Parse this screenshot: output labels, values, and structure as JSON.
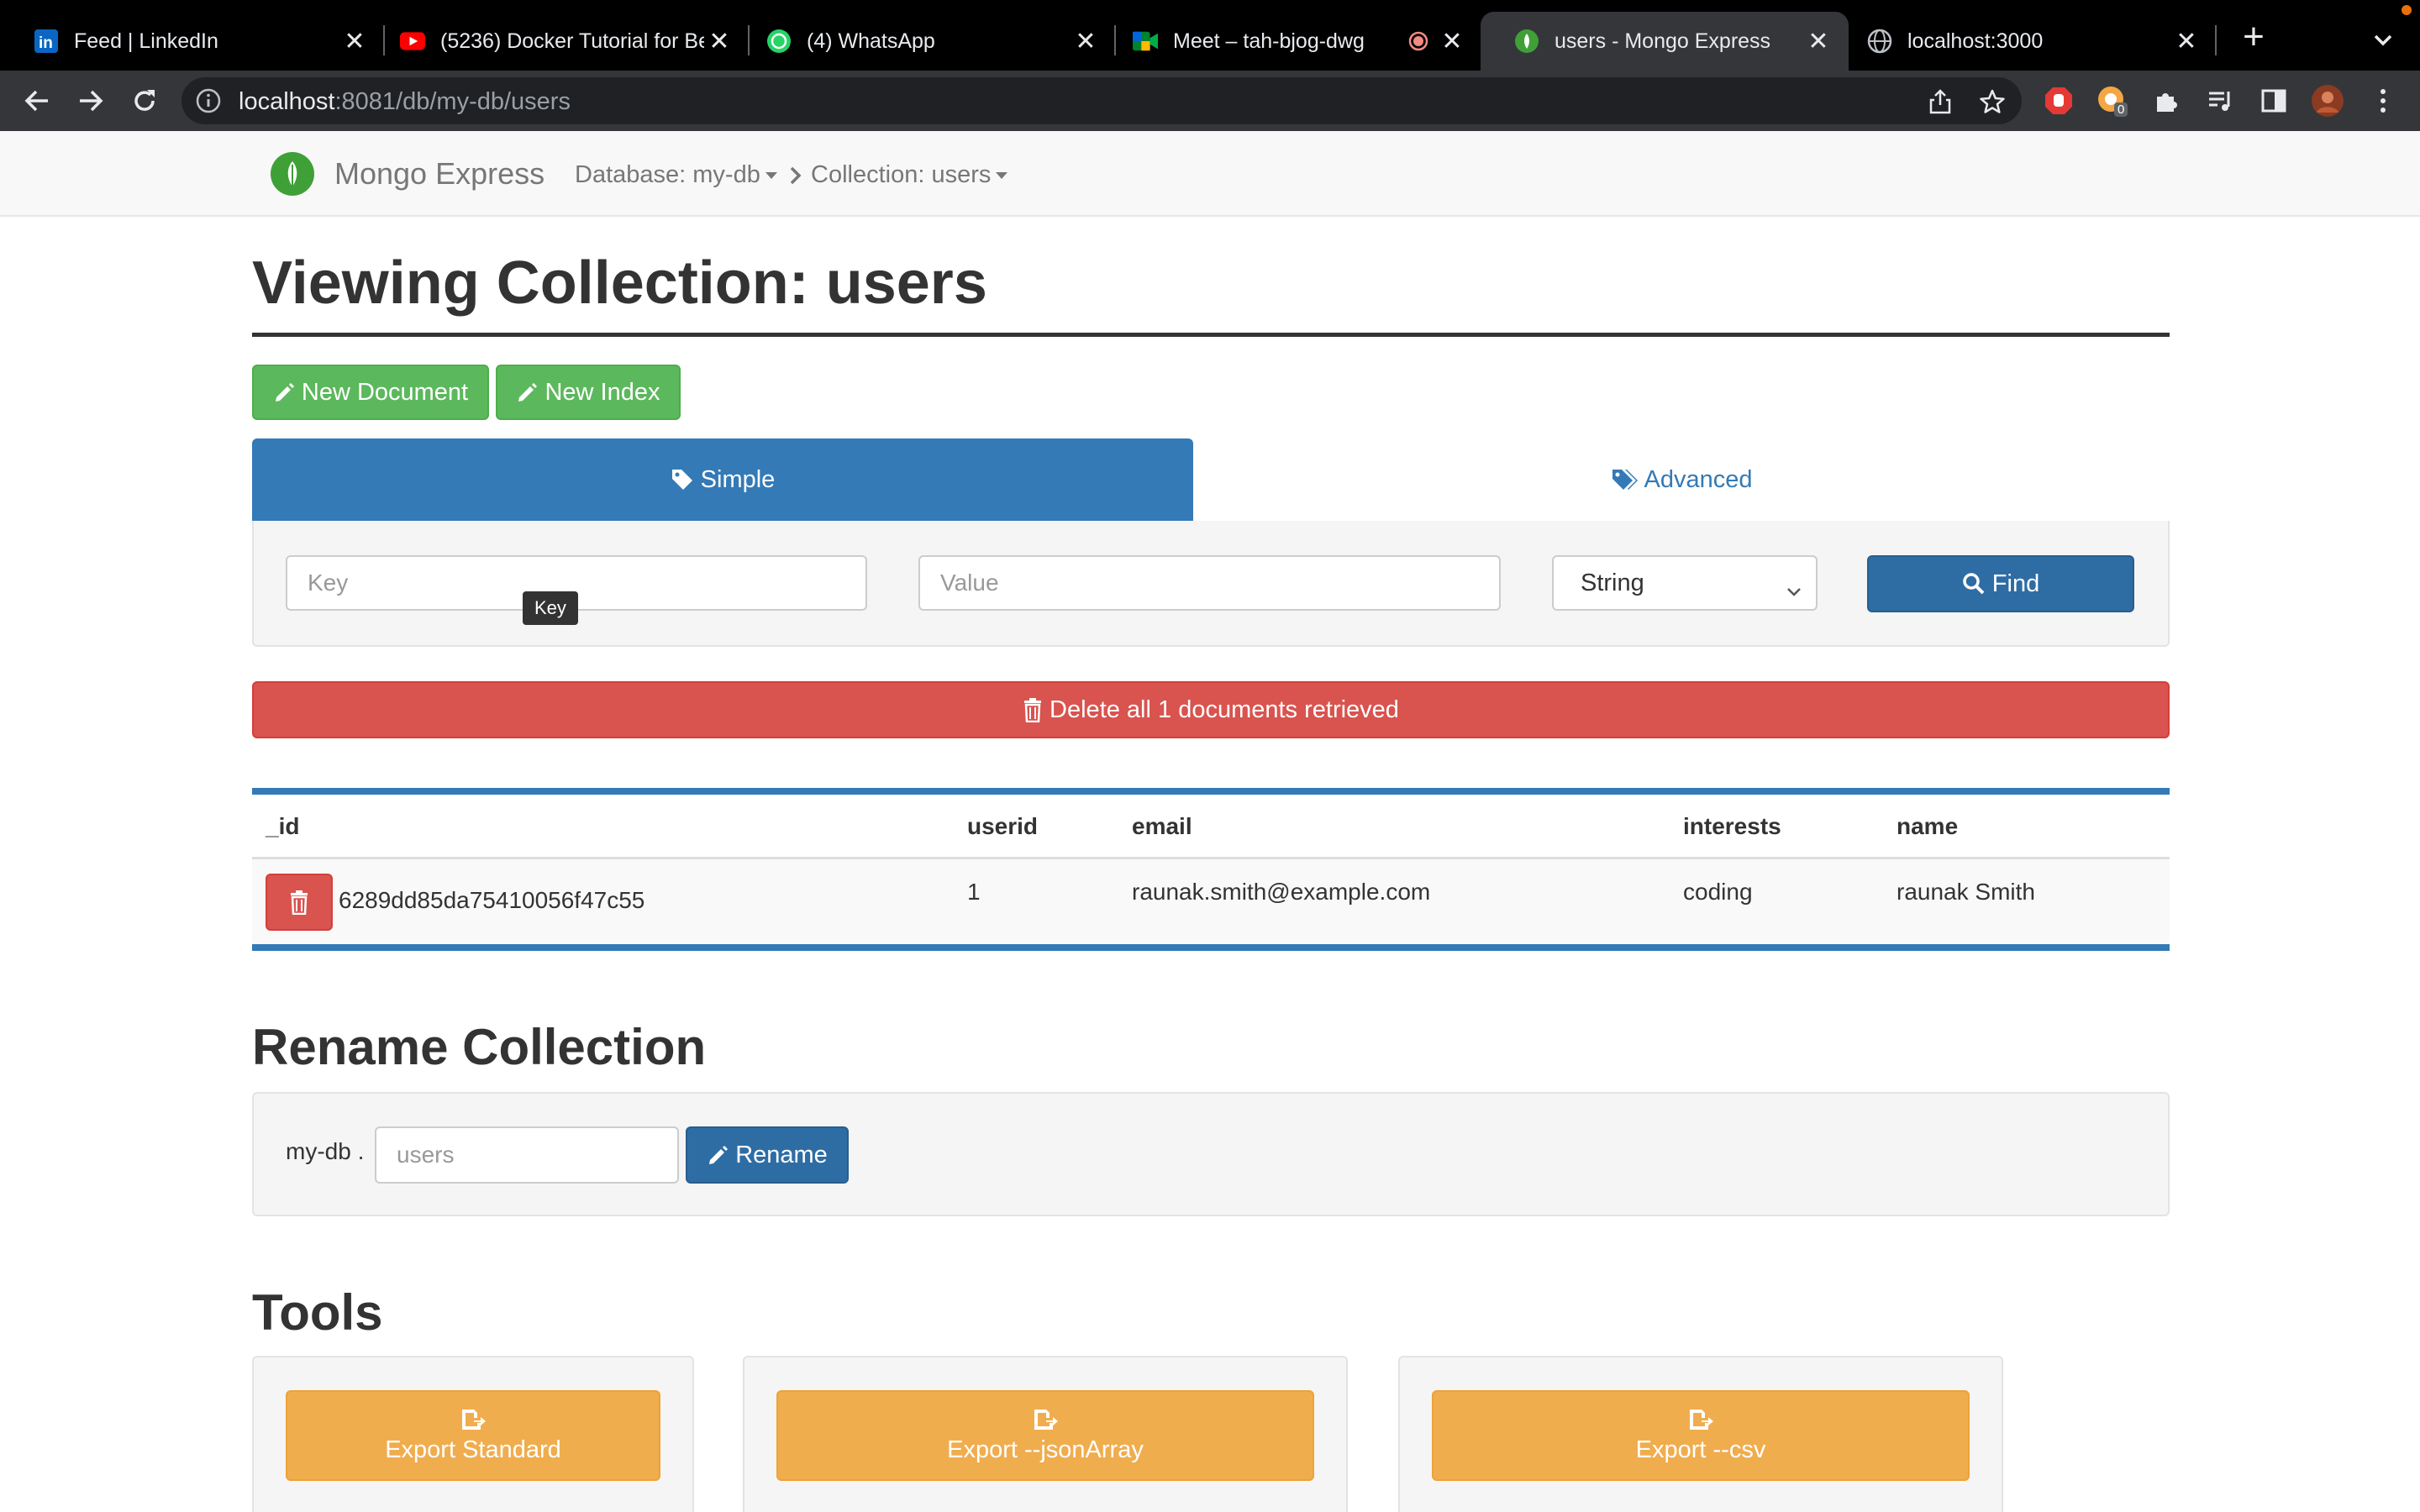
{
  "browser": {
    "tabs": [
      {
        "title": "Feed | LinkedIn",
        "icon": "linkedin-icon"
      },
      {
        "title": "(5236) Docker Tutorial for Beginners",
        "icon": "youtube-icon"
      },
      {
        "title": "(4) WhatsApp",
        "icon": "whatsapp-icon"
      },
      {
        "title": "Meet – tah-bjog-dwg",
        "icon": "google-meet-icon"
      },
      {
        "title": "users - Mongo Express",
        "icon": "mongo-leaf-icon"
      },
      {
        "title": "localhost:3000",
        "icon": "globe-icon"
      }
    ],
    "active_tab": 4,
    "url_host": "localhost",
    "url_rest": ":8081/db/my-db/users",
    "extension_badge": "0"
  },
  "app": {
    "brand": "Mongo Express",
    "database_crumb": "Database: my-db",
    "collection_crumb": "Collection: users"
  },
  "page": {
    "title": "Viewing Collection: users",
    "new_document": "New Document",
    "new_index": "New Index",
    "tab_simple": "Simple",
    "tab_advanced": "Advanced",
    "key_placeholder": "Key",
    "value_placeholder": "Value",
    "type_selected": "String",
    "find": "Find",
    "tooltip": "Key",
    "delete_all": "Delete all 1 documents retrieved"
  },
  "table": {
    "columns": [
      "_id",
      "userid",
      "email",
      "interests",
      "name"
    ],
    "rows": [
      {
        "_id": "6289dd85da75410056f47c55",
        "userid": "1",
        "email": "raunak.smith@example.com",
        "interests": "coding",
        "name": "raunak Smith"
      }
    ]
  },
  "rename": {
    "heading": "Rename Collection",
    "db_prefix": "my-db .",
    "placeholder": "users",
    "button": "Rename"
  },
  "tools": {
    "heading": "Tools",
    "export_standard": "Export Standard",
    "export_json": "Export --jsonArray",
    "export_csv": "Export --csv"
  },
  "colors": {
    "primary": "#337ab7",
    "success": "#5cb85c",
    "danger": "#d9534f",
    "warning": "#f0ad4e",
    "mongo_green": "#3fa037"
  }
}
